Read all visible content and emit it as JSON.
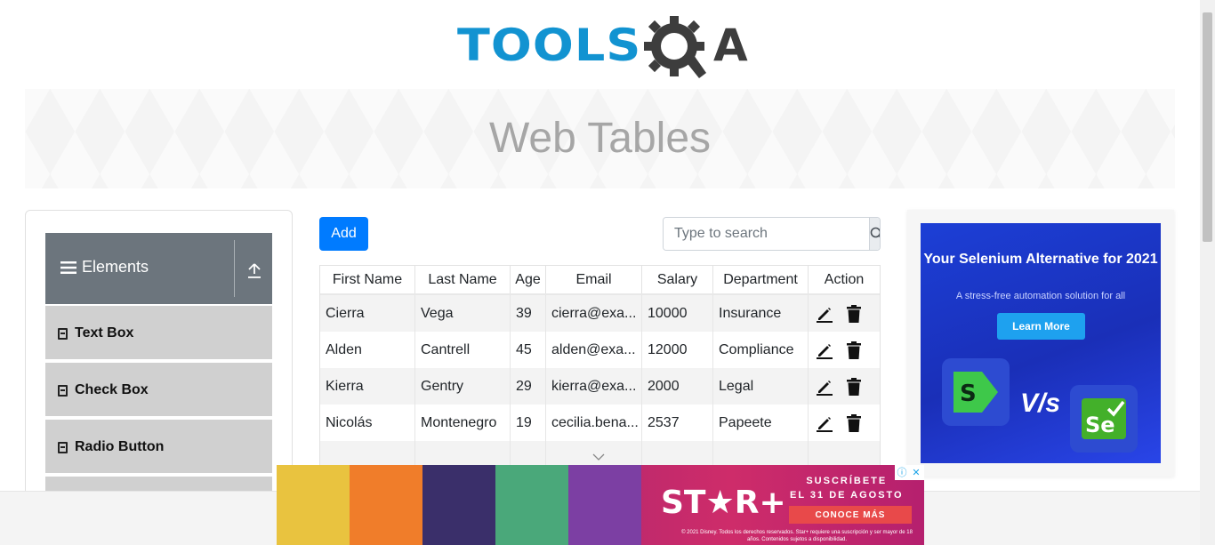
{
  "logo": {
    "text_left": "TOOLS",
    "text_right": "A"
  },
  "page_title": "Web Tables",
  "sidebar": {
    "group_label": "Elements",
    "items": [
      {
        "label": "Text Box"
      },
      {
        "label": "Check Box"
      },
      {
        "label": "Radio Button"
      }
    ]
  },
  "controls": {
    "add_label": "Add",
    "search_placeholder": "Type to search"
  },
  "table": {
    "columns": [
      "First Name",
      "Last Name",
      "Age",
      "Email",
      "Salary",
      "Department",
      "Action"
    ],
    "rows": [
      [
        "Cierra",
        "Vega",
        "39",
        "cierra@exa...",
        "10000",
        "Insurance"
      ],
      [
        "Alden",
        "Cantrell",
        "45",
        "alden@exa...",
        "12000",
        "Compliance"
      ],
      [
        "Kierra",
        "Gentry",
        "29",
        "kierra@exa...",
        "2000",
        "Legal"
      ],
      [
        "Nicolás",
        "Montenegro",
        "19",
        "cecilia.bena...",
        "2537",
        "Papeete"
      ]
    ]
  },
  "ad_right": {
    "headline": "Your Selenium Alternative for 2021",
    "subline": "A stress-free automation solution for all",
    "cta": "Learn More",
    "vs": "V/s"
  },
  "ad_bottom": {
    "brand": "ST★R+",
    "line1": "SUSCRÍBETE",
    "line2": "EL 31 DE AGOSTO",
    "cta": "CONOCE MÁS",
    "legal": "© 2021 Disney. Todos los derechos reservados. Star+ requiere una suscripción y ser mayor de 18 años. Contenidos sujetos a disponibilidad."
  },
  "colors": {
    "primary": "#007bff",
    "logo_blue": "#1293d1",
    "sidebar_header": "#6c757d"
  }
}
